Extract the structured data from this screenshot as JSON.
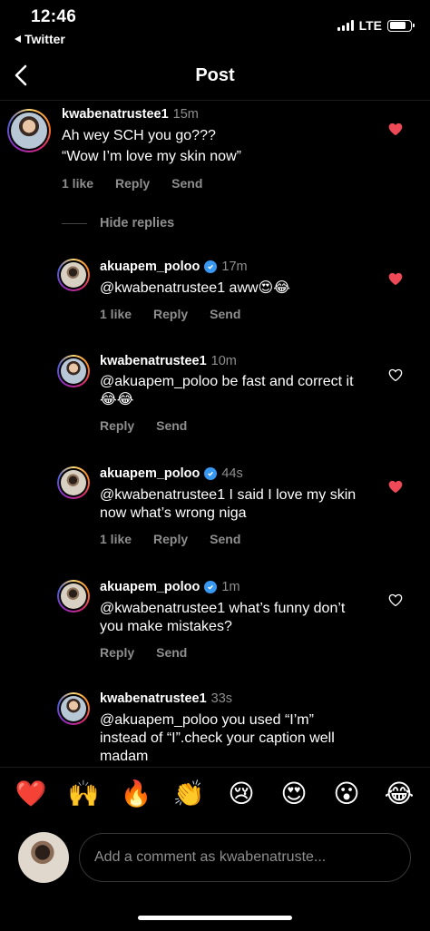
{
  "status_bar": {
    "time": "12:46",
    "back_app": "Twitter",
    "network": "LTE",
    "battery_level": 0.8
  },
  "header": {
    "title": "Post"
  },
  "comments": [
    {
      "username": "kwabenatrustee1",
      "time": "15m",
      "verified": false,
      "text_lines": [
        "Ah wey SCH you go???",
        "“Wow I’m love my skin now”"
      ],
      "likes": "1 like",
      "reply": "Reply",
      "send": "Send",
      "liked": true
    }
  ],
  "hide_replies": "Hide replies",
  "replies": [
    {
      "username": "akuapem_poloo",
      "time": "17m",
      "verified": true,
      "text": "@kwabenatrustee1 aww😍😂",
      "likes": "1 like",
      "reply": "Reply",
      "send": "Send",
      "liked": true
    },
    {
      "username": "kwabenatrustee1",
      "time": "10m",
      "verified": false,
      "text": "@akuapem_poloo be fast and correct it 😂😂",
      "likes": "",
      "reply": "Reply",
      "send": "Send",
      "liked": false
    },
    {
      "username": "akuapem_poloo",
      "time": "44s",
      "verified": true,
      "text": "@kwabenatrustee1 I said I love my skin now what’s wrong niga",
      "likes": "1 like",
      "reply": "Reply",
      "send": "Send",
      "liked": true
    },
    {
      "username": "akuapem_poloo",
      "time": "1m",
      "verified": true,
      "text": "@kwabenatrustee1 what’s funny don’t you make mistakes?",
      "likes": "",
      "reply": "Reply",
      "send": "Send",
      "liked": false
    },
    {
      "username": "kwabenatrustee1",
      "time": "33s",
      "verified": false,
      "text": "@akuapem_poloo you used “I’m” instead of “I”.check your caption well madam",
      "likes": "",
      "reply": "",
      "send": "",
      "liked": false
    }
  ],
  "emoji_bar": [
    "❤️",
    "🙌",
    "🔥",
    "👏",
    "😢",
    "😍",
    "😮",
    "😂"
  ],
  "composer": {
    "placeholder": "Add a comment as kwabenatruste..."
  },
  "colors": {
    "like_red": "#ed4956",
    "muted": "#8e8e8e",
    "verified_blue": "#3897f0"
  }
}
